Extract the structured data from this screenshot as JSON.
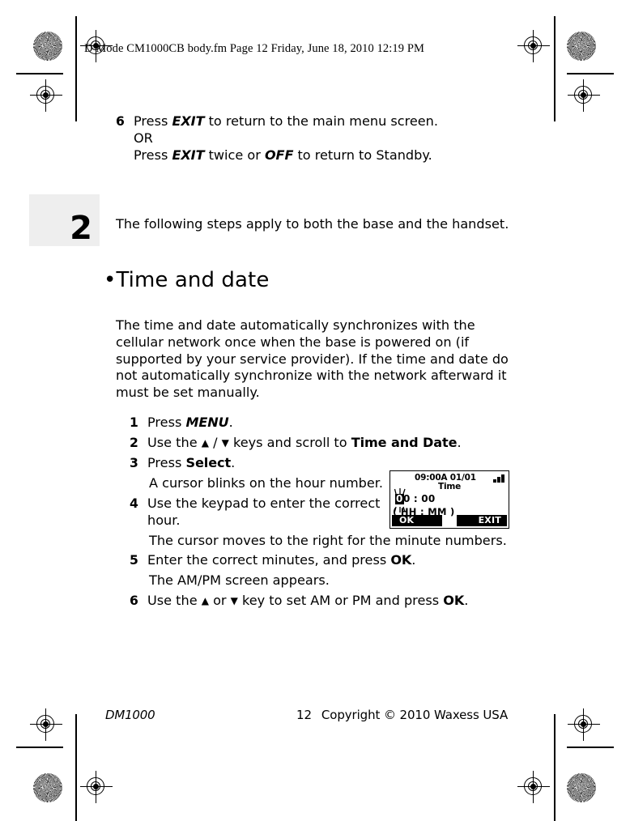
{
  "header": {
    "text": "D Mode CM1000CB body.fm  Page 12  Friday, June 18, 2010  12:19 PM"
  },
  "chapter_tab": {
    "number": "2"
  },
  "top_step": {
    "number": "6",
    "line1_pre": "Press ",
    "line1_em": "EXIT",
    "line1_post": " to return to the main menu screen.",
    "or": "OR",
    "line2_pre": "Press ",
    "line2_em1": "EXIT",
    "line2_mid": " twice or ",
    "line2_em2": "OFF",
    "line2_post": " to return to Standby."
  },
  "both_note": "The following steps apply to both the base and the handset.",
  "section": {
    "bullet": "•",
    "title": "Time and date"
  },
  "intro_paragraph": "The time and date automatically synchronizes with the cellular network once when the base is powered on (if supported by your service provider).  If the time and date do not automatically synchronize with the network afterward it must be set manually.",
  "steps": [
    {
      "number": "1",
      "pre": "Press ",
      "em": "MENU",
      "post": "."
    },
    {
      "number": "2",
      "pre": "Use the ",
      "keys_up": "▲",
      "keys_sep": " / ",
      "keys_dn": "▼",
      "mid": " keys and scroll to ",
      "lcd_label": "Time and Date",
      "post": "."
    },
    {
      "number": "3",
      "pre": "Press ",
      "lcd_label": "Select",
      "post": "."
    }
  ],
  "step3_sub": "A cursor blinks on the hour number.",
  "step4": {
    "number": "4",
    "text": "Use the keypad to enter the correct hour.",
    "sub": "The cursor moves to the right for the minute numbers."
  },
  "step5": {
    "number": "5",
    "pre": "Enter the correct minutes, and press ",
    "lcd_label": "OK",
    "post": ".",
    "sub": "The AM/PM screen appears."
  },
  "step6": {
    "number": "6",
    "pre": "Use the ",
    "key_up": "▲",
    "mid": " or ",
    "key_dn": "▼",
    "post": " key to set AM or PM and press ",
    "lcd_label": "OK",
    "end": "."
  },
  "lcd": {
    "clock": "09:00A 01/01",
    "title": "Time",
    "hour_cursor": "0",
    "time_rest": "0 : 00",
    "format": "( HH : MM )",
    "softkey_left": "OK",
    "softkey_right": "EXIT"
  },
  "footer": {
    "left": "DM1000",
    "page": "12",
    "copyright": "Copyright © 2010 Waxess USA"
  }
}
